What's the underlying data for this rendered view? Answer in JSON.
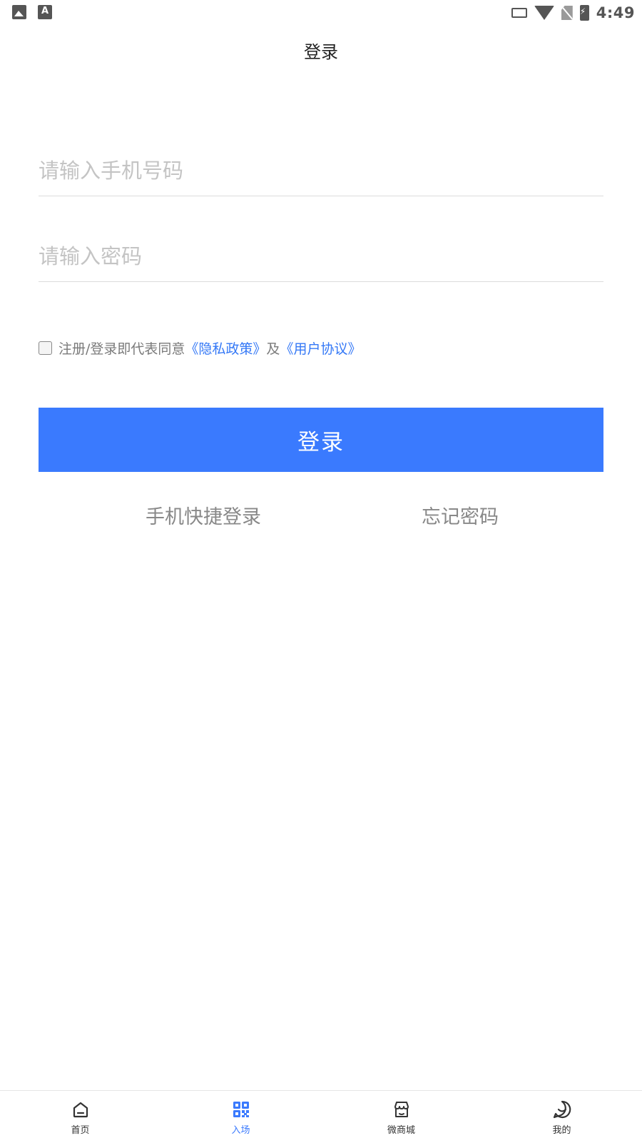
{
  "status_bar": {
    "time": "4:49",
    "left_icons": [
      "image-icon",
      "a-icon"
    ],
    "right_icons": [
      "cast-icon",
      "wifi-icon",
      "no-sim-icon",
      "battery-icon"
    ]
  },
  "header": {
    "title": "登录"
  },
  "form": {
    "phone_placeholder": "请输入手机号码",
    "password_placeholder": "请输入密码",
    "agreement_prefix": "注册/登录即代表同意",
    "privacy_link": "《隐私政策》",
    "agreement_and": "及",
    "terms_link": "《用户协议》",
    "login_button": "登录",
    "quick_login": "手机快捷登录",
    "forgot_password": "忘记密码"
  },
  "tabbar": {
    "items": [
      {
        "label": "首页",
        "icon": "home-icon"
      },
      {
        "label": "入场",
        "icon": "qr-code-icon",
        "active": true
      },
      {
        "label": "微商城",
        "icon": "shop-icon"
      },
      {
        "label": "我的",
        "icon": "profile-icon"
      }
    ]
  },
  "colors": {
    "accent": "#3a7afe",
    "link": "#3478f6"
  }
}
